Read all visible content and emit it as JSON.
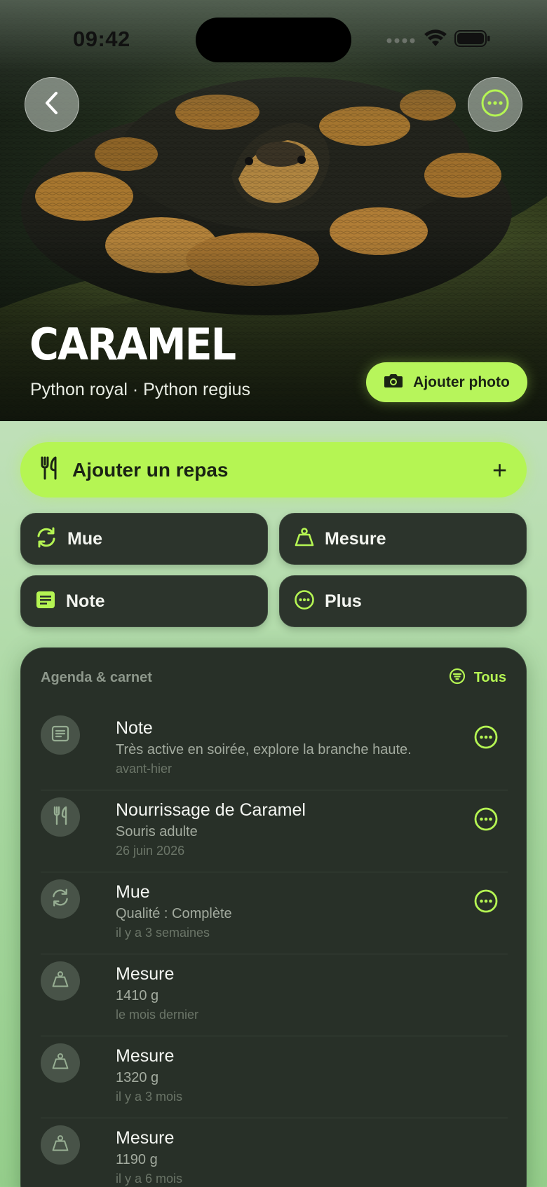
{
  "status_bar": {
    "time": "09:42"
  },
  "hero": {
    "name": "CARAMEL",
    "species": "Python royal · Python regius",
    "add_photo_label": "Ajouter photo"
  },
  "actions": {
    "add_meal_label": "Ajouter un repas",
    "add_meal_plus": "+",
    "tiles": [
      {
        "label": "Mue",
        "icon": "shed-cycle-icon"
      },
      {
        "label": "Mesure",
        "icon": "weight-scale-icon"
      },
      {
        "label": "Note",
        "icon": "note-icon"
      },
      {
        "label": "Plus",
        "icon": "more-icon"
      }
    ]
  },
  "agenda": {
    "title": "Agenda & carnet",
    "filter_label": "Tous",
    "entries": [
      {
        "title": "Note",
        "subtitle": "Très active en soirée, explore la branche haute.",
        "time": "avant-hier",
        "icon": "note-icon",
        "has_menu": true
      },
      {
        "title": "Nourrissage de Caramel",
        "subtitle": "Souris adulte",
        "time": "26 juin 2026",
        "icon": "fork-knife-icon",
        "has_menu": true
      },
      {
        "title": "Mue",
        "subtitle": "Qualité : Complète",
        "time": "il y a 3 semaines",
        "icon": "shed-cycle-icon",
        "has_menu": true
      },
      {
        "title": "Mesure",
        "subtitle": "1410 g",
        "time": "le mois dernier",
        "icon": "weight-scale-icon",
        "has_menu": false
      },
      {
        "title": "Mesure",
        "subtitle": "1320 g",
        "time": "il y a 3 mois",
        "icon": "weight-scale-icon",
        "has_menu": false
      },
      {
        "title": "Mesure",
        "subtitle": "1190 g",
        "time": "il y a 6 mois",
        "icon": "weight-scale-icon",
        "has_menu": false
      }
    ]
  },
  "colors": {
    "accent": "#b5f553",
    "card": "#283028",
    "tile": "#2c342c",
    "background": "#c4e2bd"
  }
}
